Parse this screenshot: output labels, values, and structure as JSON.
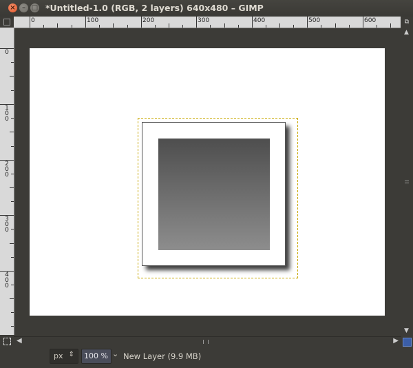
{
  "window": {
    "title": "*Untitled-1.0 (RGB, 2 layers) 640x480 – GIMP",
    "close_glyph": "×",
    "minimize_glyph": "–",
    "maximize_glyph": "□"
  },
  "rulers": {
    "horizontal_labels": [
      "0",
      "100",
      "200",
      "300",
      "400",
      "500",
      "600"
    ],
    "vertical_labels": [
      "0",
      "100",
      "200",
      "300",
      "400"
    ]
  },
  "scrollbars": {
    "up_glyph": "▲",
    "down_glyph": "▼",
    "left_glyph": "◀",
    "right_glyph": "▶"
  },
  "statusbar": {
    "unit": "px",
    "unit_arrows": "⌃⌄",
    "zoom": "100 %",
    "zoom_arrow": "⌄",
    "message": "New Layer (9.9 MB)"
  },
  "colors": {
    "workspace": "#3c3b37",
    "canvas": "#ffffff",
    "gradient_top": "#4e4e4e",
    "gradient_bottom": "#8d8d8d",
    "layer_boundary": "#c9a800",
    "close_button": "#e2552b"
  }
}
